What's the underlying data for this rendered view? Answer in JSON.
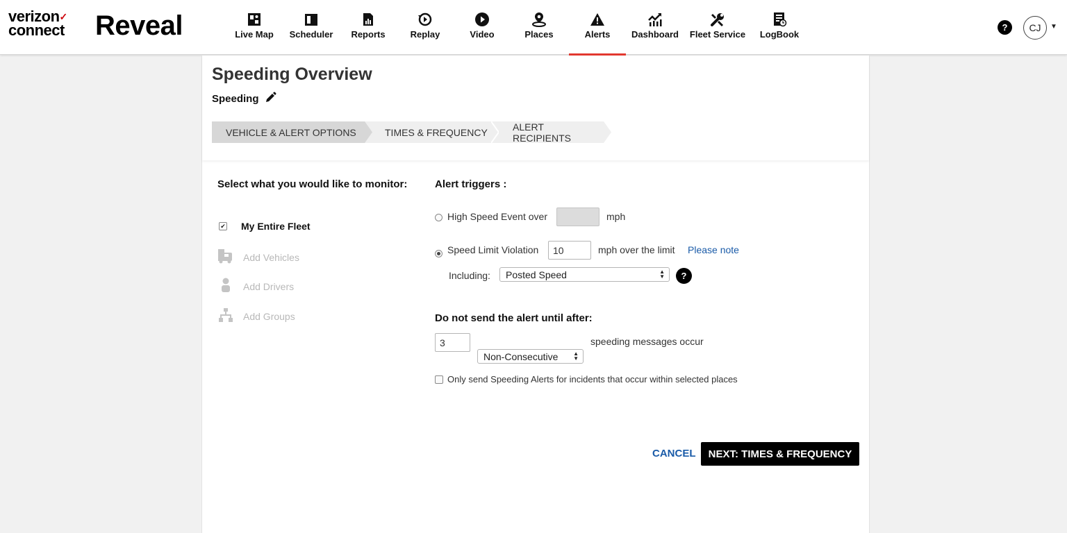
{
  "brand": {
    "line1": "verizon",
    "check": "✓",
    "line2": "connect",
    "product": "Reveal"
  },
  "nav": {
    "items": [
      {
        "label": "Live Map",
        "icon": "map-icon"
      },
      {
        "label": "Scheduler",
        "icon": "scheduler-icon"
      },
      {
        "label": "Reports",
        "icon": "reports-icon"
      },
      {
        "label": "Replay",
        "icon": "replay-icon"
      },
      {
        "label": "Video",
        "icon": "video-icon"
      },
      {
        "label": "Places",
        "icon": "places-icon"
      },
      {
        "label": "Alerts",
        "icon": "alert-icon",
        "active": true
      },
      {
        "label": "Dashboard",
        "icon": "dashboard-icon"
      },
      {
        "label": "Fleet Service",
        "icon": "wrench-icon"
      },
      {
        "label": "LogBook",
        "icon": "logbook-icon"
      }
    ],
    "help": "?",
    "avatar": "CJ"
  },
  "page": {
    "title": "Speeding Overview",
    "subtitle": "Speeding",
    "steps": [
      "VEHICLE & ALERT OPTIONS",
      "TIMES & FREQUENCY",
      "ALERT RECIPIENTS"
    ]
  },
  "monitor": {
    "heading": "Select what you would like to monitor:",
    "entire_fleet": "My Entire Fleet",
    "entire_fleet_checked": true,
    "add_vehicles": "Add Vehicles",
    "add_drivers": "Add Drivers",
    "add_groups": "Add Groups"
  },
  "triggers": {
    "heading": "Alert triggers :",
    "high_speed_label": "High Speed Event over",
    "high_speed_value": "",
    "high_speed_unit": "mph",
    "speed_limit_label": "Speed Limit Violation",
    "speed_limit_value": "10",
    "speed_limit_unit": "mph over the limit",
    "please_note": "Please note",
    "including_label": "Including:",
    "including_value": "Posted Speed",
    "selected": "speed_limit"
  },
  "delay": {
    "heading": "Do not send the alert until after:",
    "count": "3",
    "mode": "Non-Consecutive",
    "suffix": "speeding messages occur",
    "places_only_label": "Only send Speeding Alerts for incidents that occur within selected places",
    "places_only_checked": false
  },
  "actions": {
    "cancel": "CANCEL",
    "next": "NEXT: TIMES & FREQUENCY"
  }
}
